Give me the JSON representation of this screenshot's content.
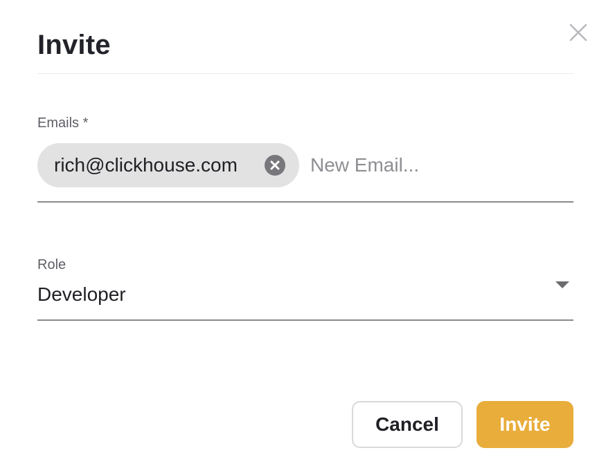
{
  "dialog": {
    "title": "Invite",
    "close_icon": "close-icon"
  },
  "emails": {
    "label": "Emails *",
    "chips": [
      {
        "value": "rich@clickhouse.com",
        "remove_icon": "clear-circle-icon"
      }
    ],
    "placeholder": "New Email..."
  },
  "role": {
    "label": "Role",
    "selected": "Developer",
    "caret_icon": "caret-down-icon"
  },
  "actions": {
    "cancel_label": "Cancel",
    "invite_label": "Invite"
  },
  "colors": {
    "accent": "#e8ad3b",
    "chip_bg": "#e2e2e3",
    "divider": "#ececee"
  }
}
